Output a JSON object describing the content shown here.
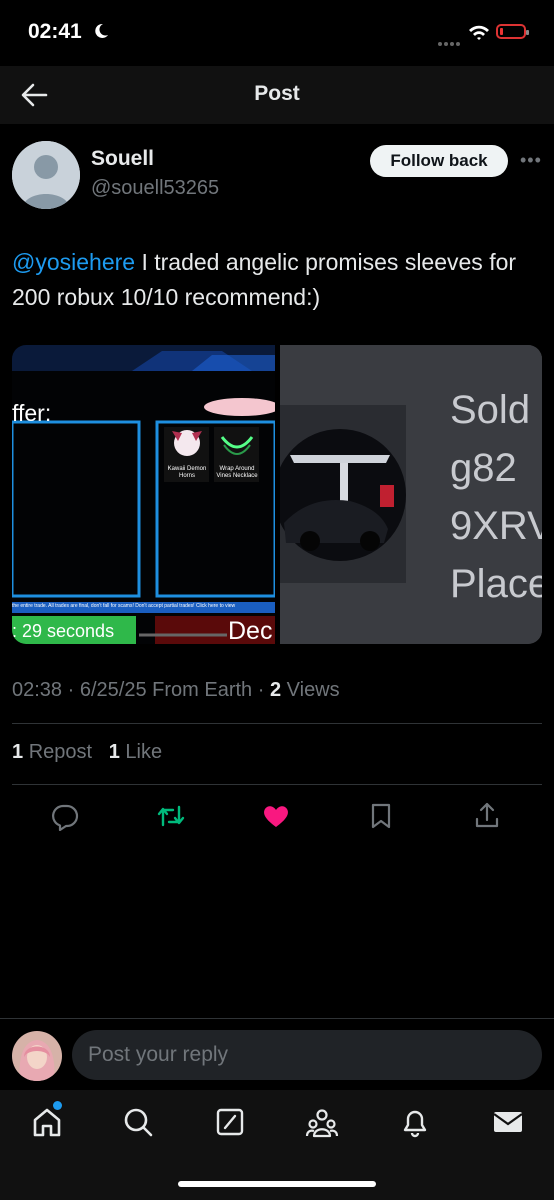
{
  "status_bar": {
    "time": "02:41"
  },
  "nav": {
    "title": "Post"
  },
  "author": {
    "name": "Souell",
    "handle": "@souell53265",
    "follow_label": "Follow back"
  },
  "post": {
    "mention": "@yosiehere",
    "text": " I traded angelic promises sleeves for 200 robux 10/10 recommend:)",
    "time": "02:38",
    "date": "6/25/25",
    "location": "From Earth",
    "views_count": "2",
    "views_label": "Views"
  },
  "media": {
    "image1": {
      "offer_text": "ffer:",
      "item1_label": "Kawaii Demon Horns",
      "item2_label": "Wrap Around Vines Necklace",
      "ticker": "the entire trade. All trades are final, don't fall for scams! Don't accept partial trades! Click here to view",
      "timer": ": 29 seconds",
      "decline": "Dec"
    },
    "image2": {
      "lines": [
        "Sold",
        "g82",
        "9XRV",
        "Place"
      ]
    }
  },
  "engagement": {
    "repost_count": "1",
    "repost_label": "Repost",
    "like_count": "1",
    "like_label": "Like"
  },
  "colors": {
    "accent": "#1d9bf0",
    "like": "#f91880",
    "repost": "#00ba7c",
    "background": "#000000"
  },
  "actions": [
    "reply-icon",
    "repost-icon",
    "like-icon",
    "bookmark-icon",
    "share-icon"
  ],
  "reply": {
    "placeholder": "Post your reply"
  },
  "tabbar": [
    "home-icon",
    "search-icon",
    "grok-icon",
    "communities-icon",
    "notifications-icon",
    "messages-icon"
  ]
}
